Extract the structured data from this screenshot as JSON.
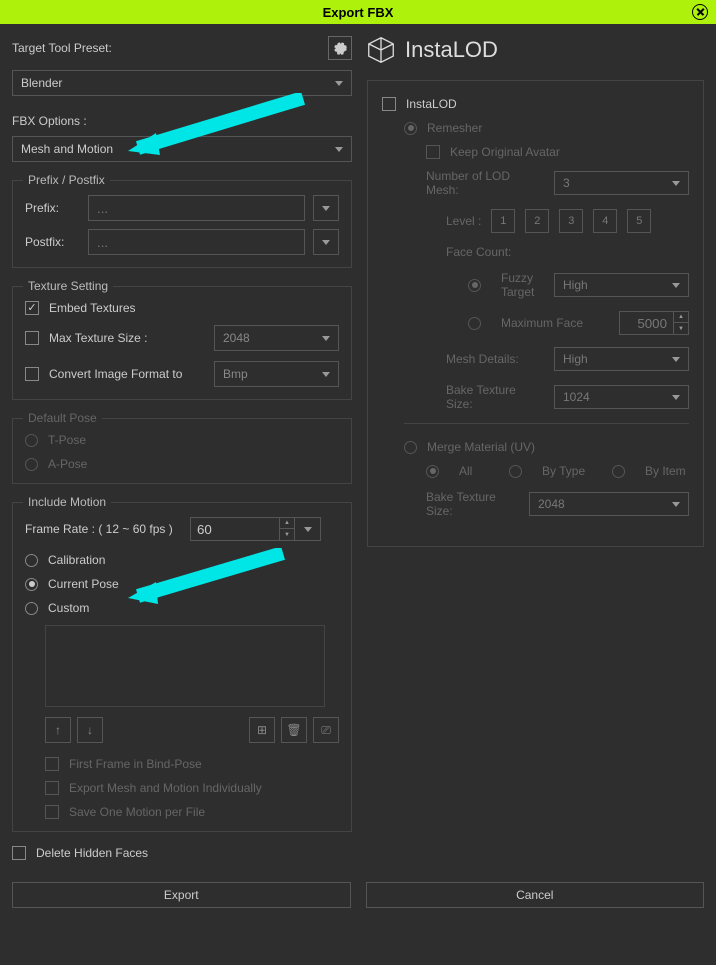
{
  "title": "Export FBX",
  "left": {
    "targetPresetLabel": "Target Tool Preset:",
    "targetPreset": "Blender",
    "fbxOptionsLabel": "FBX Options :",
    "fbxOptions": "Mesh and Motion",
    "prefixPostfix": {
      "legend": "Prefix / Postfix",
      "prefixLabel": "Prefix:",
      "prefixPlaceholder": "...",
      "postfixLabel": "Postfix:",
      "postfixPlaceholder": "..."
    },
    "textureSetting": {
      "legend": "Texture Setting",
      "embed": "Embed Textures",
      "maxSizeLabel": "Max Texture Size :",
      "maxSize": "2048",
      "convertLabel": "Convert Image Format to",
      "convert": "Bmp"
    },
    "defaultPose": {
      "legend": "Default Pose",
      "tpose": "T-Pose",
      "apose": "A-Pose"
    },
    "includeMotion": {
      "legend": "Include Motion",
      "frameRateLabel": "Frame Rate : ( 12 ~ 60 fps )",
      "frameRate": "60",
      "calibration": "Calibration",
      "currentPose": "Current Pose",
      "custom": "Custom",
      "firstFrame": "First Frame in Bind-Pose",
      "exportIndiv": "Export Mesh and Motion Individually",
      "saveOne": "Save One Motion per File"
    },
    "deleteHidden": "Delete Hidden Faces",
    "exportBtn": "Export",
    "cancelBtn": "Cancel"
  },
  "right": {
    "brand": "InstaLOD",
    "instalod": "InstaLOD",
    "remesher": "Remesher",
    "keepOriginal": "Keep Original Avatar",
    "numLodLabel": "Number of LOD Mesh:",
    "numLod": "3",
    "levelLabel": "Level :",
    "levels": [
      "1",
      "2",
      "3",
      "4",
      "5"
    ],
    "faceCountLabel": "Face Count:",
    "fuzzy": "Fuzzy Target",
    "fuzzyVal": "High",
    "maxFace": "Maximum Face",
    "maxFaceVal": "5000",
    "meshDetails": "Mesh Details:",
    "meshDetailsVal": "High",
    "bakeTex": "Bake Texture Size:",
    "bakeTexVal": "1024",
    "mergeMat": "Merge Material (UV)",
    "all": "All",
    "byType": "By Type",
    "byItem": "By Item",
    "bakeTex2": "Bake Texture Size:",
    "bakeTex2Val": "2048"
  }
}
